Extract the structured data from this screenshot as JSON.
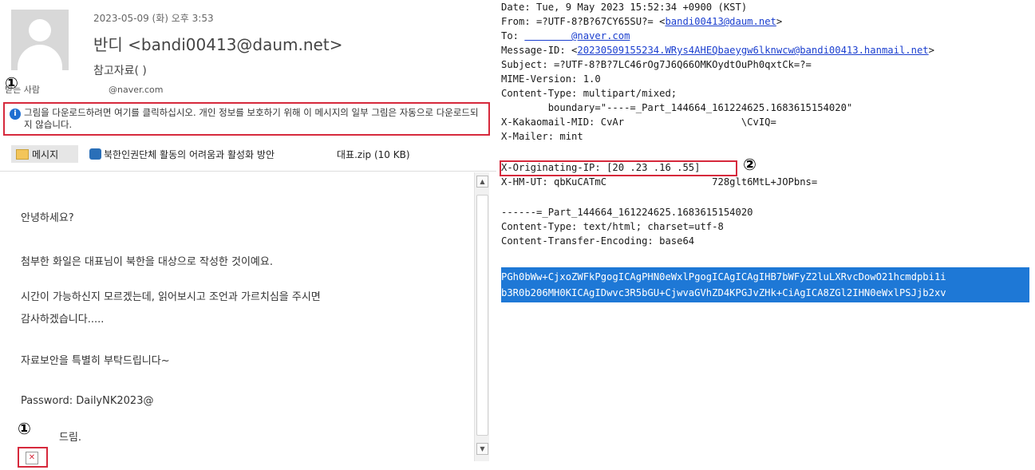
{
  "email": {
    "date": "2023-05-09 (화) 오후 3:53",
    "from": "반디 <bandi00413@daum.net>",
    "subject": "참고자료(      )",
    "recipient_label": "받는 사람",
    "recipient_value": "@naver.com",
    "notice": "그림을 다운로드하려면 여기를 클릭하십시오. 개인 정보를 보호하기 위해 이 메시지의 일부 그림은 자동으로 다운로드되지 않습니다.",
    "tab_message": "메시지",
    "attachment_doc": "북한인권단체 활동의 어려움과 활성화 방안",
    "attachment_zip": "대표.zip (10 KB)",
    "body": [
      "안녕하세요?",
      "첨부한 화일은                              대표님이 북한을 대상으로 작성한 것이예요.",
      "시간이 가능하신지 모르겠는데, 읽어보시고 조언과 가르치심을 주시면",
      "감사하겠습니다.....",
      "자료보안을 특별히 부탁드립니다~",
      "Password: DailyNK2023@",
      "드림."
    ],
    "marker1": "①",
    "marker2": "②"
  },
  "headers": {
    "date_line": "Date: Tue, 9 May 2023 15:52:34 +0900 (KST)",
    "from_prefix": "From: =?UTF-8?B?67CY65SU?= <",
    "from_email": "bandi00413@daum.net",
    "from_suffix": ">",
    "to_prefix": "To: ",
    "to_email": "        @naver.com",
    "msgid_prefix": "Message-ID: <",
    "msgid_value": "20230509155234.WRys4AHEQbaeygw6lknwcw@bandi00413.hanmail.net",
    "msgid_suffix": ">",
    "subject_line": "Subject: =?UTF-8?B?7LC46rOg7J6Q66OMKOydtOuPh0qxtCk=?=",
    "mime_line": "MIME-Version: 1.0",
    "ctype_line": "Content-Type: multipart/mixed;",
    "boundary_line": "        boundary=\"----=_Part_144664_161224625.1683615154020\"",
    "kakao_line": "X-Kakaomail-MID: CvAr                    \\CvIQ=",
    "mailer_line": "X-Mailer: mint",
    "origip_line": "X-Originating-IP: [20 .23 .16 .55]",
    "hmut_line": "X-HM-UT: qbKuCATmC                  728glt6MtL+JOPbns=",
    "part_line": "------=_Part_144664_161224625.1683615154020",
    "part_ctype": "Content-Type: text/html; charset=utf-8",
    "part_cte": "Content-Transfer-Encoding: base64",
    "b64_line1": "PGh0bWw+CjxoZWFkPgogICAgPHN0eWxlPgogICAgICAgIHB7bWFyZ2luLXRvcDowO21hcmdpbi1i",
    "b64_line2": "b3R0b206MH0KICAgIDwvc3R5bGU+CjwvaGVhZD4KPGJvZHk+CiAgICA8ZGl2IHN0eWxlPSJjb2xv"
  }
}
